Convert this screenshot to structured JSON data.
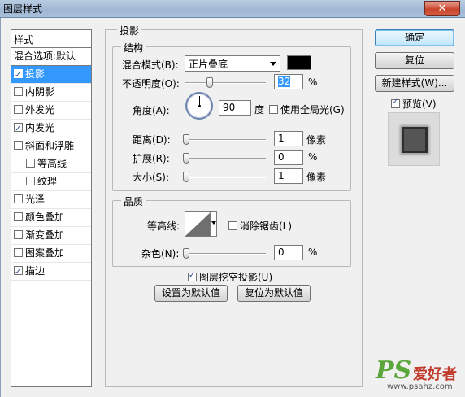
{
  "window": {
    "title": "图层样式",
    "close_label": "✕"
  },
  "styles": {
    "header": "样式",
    "blend_options": "混合选项:默认",
    "items": [
      {
        "label": "投影",
        "checked": true,
        "selected": true,
        "sub": false
      },
      {
        "label": "内阴影",
        "checked": false,
        "selected": false,
        "sub": false
      },
      {
        "label": "外发光",
        "checked": false,
        "selected": false,
        "sub": false
      },
      {
        "label": "内发光",
        "checked": true,
        "selected": false,
        "sub": false
      },
      {
        "label": "斜面和浮雕",
        "checked": false,
        "selected": false,
        "sub": false
      },
      {
        "label": "等高线",
        "checked": false,
        "selected": false,
        "sub": true
      },
      {
        "label": "纹理",
        "checked": false,
        "selected": false,
        "sub": true
      },
      {
        "label": "光泽",
        "checked": false,
        "selected": false,
        "sub": false
      },
      {
        "label": "颜色叠加",
        "checked": false,
        "selected": false,
        "sub": false
      },
      {
        "label": "渐变叠加",
        "checked": false,
        "selected": false,
        "sub": false
      },
      {
        "label": "图案叠加",
        "checked": false,
        "selected": false,
        "sub": false
      },
      {
        "label": "描边",
        "checked": true,
        "selected": false,
        "sub": false
      }
    ]
  },
  "panel": {
    "title": "投影",
    "structure": {
      "title": "结构",
      "blend_mode_label": "混合模式(B):",
      "blend_mode_value": "正片叠底",
      "opacity_label": "不透明度(O):",
      "opacity_value": "32",
      "opacity_unit": "%",
      "angle_label": "角度(A):",
      "angle_value": "90",
      "angle_unit": "度",
      "global_light_label": "使用全局光(G)",
      "distance_label": "距离(D):",
      "distance_value": "1",
      "distance_unit": "像素",
      "spread_label": "扩展(R):",
      "spread_value": "0",
      "spread_unit": "%",
      "size_label": "大小(S):",
      "size_value": "1",
      "size_unit": "像素"
    },
    "quality": {
      "title": "品质",
      "contour_label": "等高线:",
      "antialias_label": "消除锯齿(L)",
      "noise_label": "杂色(N):",
      "noise_value": "0",
      "noise_unit": "%"
    },
    "knockout_label": "图层挖空投影(U)",
    "make_default_label": "设置为默认值",
    "reset_default_label": "复位为默认值"
  },
  "buttons": {
    "ok": "确定",
    "reset": "复位",
    "new_style": "新建样式(W)...",
    "preview_label": "预览(V)"
  },
  "watermark": {
    "ps": "PS",
    "cn": "爱好者",
    "url": "www.psahz.com"
  },
  "colors": {
    "accent": "#3399ff",
    "shadow_color": "#000000"
  }
}
